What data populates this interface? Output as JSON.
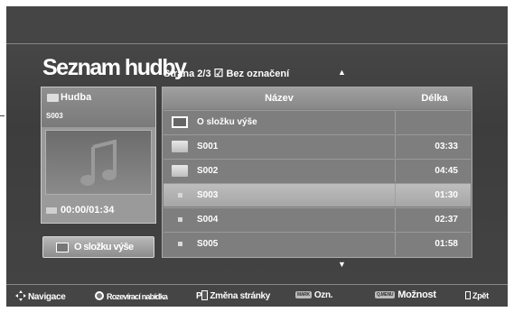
{
  "page": {
    "title": "Seznam hudby",
    "page_label": "Strana 2/3",
    "selection_status": "Bez označení",
    "scroll_up_glyph": "▲",
    "scroll_down_glyph": "▼"
  },
  "left_panel": {
    "folder_name": "Hudba",
    "current_track": "S003",
    "time": "00:00/01:34",
    "up_button": "O složku výše",
    "art_icon": "music-note-icon"
  },
  "table": {
    "headers": {
      "name": "Název",
      "length": "Délka"
    },
    "rows": [
      {
        "type": "up",
        "name": "O složku výše",
        "length": ""
      },
      {
        "type": "folder",
        "name": "S001",
        "length": "03:33"
      },
      {
        "type": "folder",
        "name": "S002",
        "length": "04:45"
      },
      {
        "type": "file",
        "name": "S003",
        "length": "01:30",
        "selected": true
      },
      {
        "type": "file",
        "name": "S004",
        "length": "02:37"
      },
      {
        "type": "file",
        "name": "S005",
        "length": "01:58"
      }
    ]
  },
  "footer": {
    "nav": "Navigace",
    "popup": "Rozevírací nabídka",
    "page_key": "P",
    "page_change": "Změna stránky",
    "mark_key": "MARK",
    "mark": "Ozn.",
    "qmenu_key": "Q.MENU",
    "options": "Možnost",
    "back": "Zpět"
  },
  "colors": {
    "background": "#444444",
    "selected_row": "#b0b0b0",
    "text": "#ffffff"
  }
}
